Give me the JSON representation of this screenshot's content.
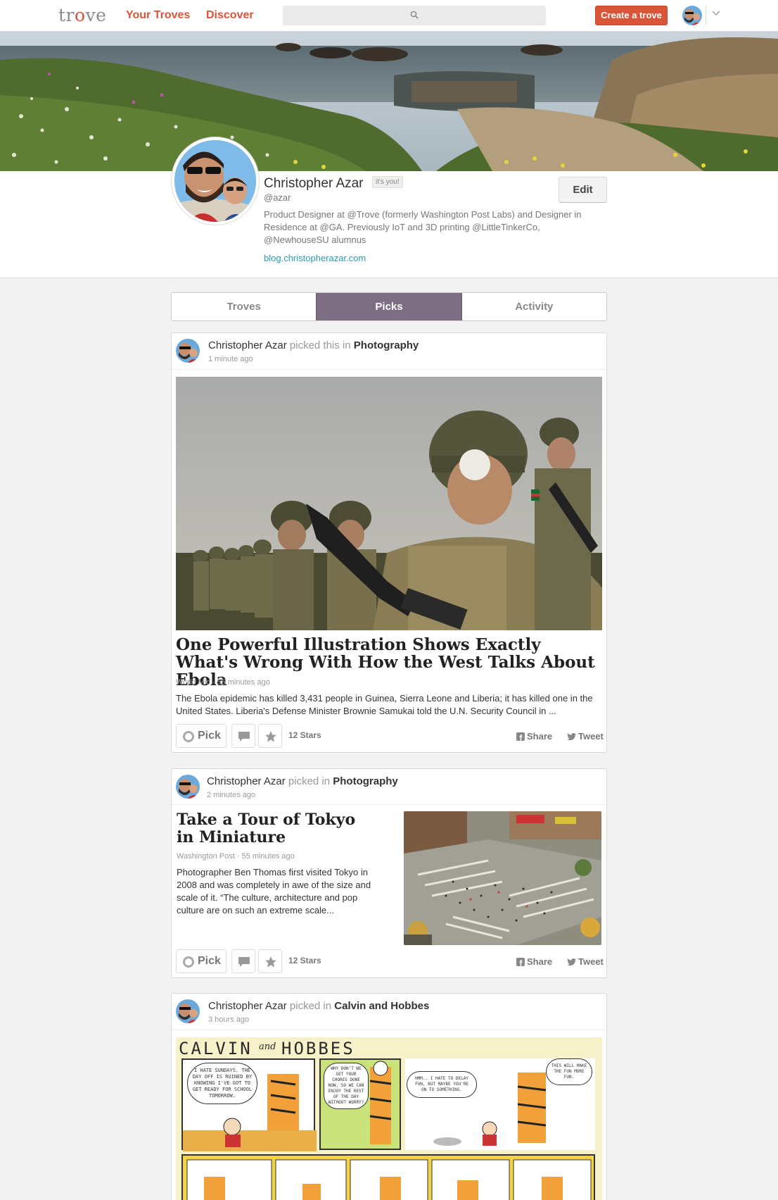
{
  "nav": {
    "logo": "trove",
    "your_troves": "Your Troves",
    "discover": "Discover",
    "search_placeholder": "",
    "create_trove": "Create a trove"
  },
  "profile": {
    "name": "Christopher Azar",
    "badge": "it's you!",
    "handle": "@azar",
    "bio": "Product Designer at @Trove (formerly Washington Post Labs) and Designer in Residence at @GA. Previously IoT and 3D printing @LittleTinkerCo, @NewhouseSU alumnus",
    "blog": "blog.christopherazar.com",
    "edit_label": "Edit"
  },
  "tabs": [
    {
      "label": "Troves",
      "active": false
    },
    {
      "label": "Picks",
      "active": true
    },
    {
      "label": "Activity",
      "active": false
    }
  ],
  "cards": [
    {
      "user": "Christopher Azar",
      "verb": "picked this in",
      "trove": "Photography",
      "ago": "1 minute ago",
      "title": "One Powerful Illustration Shows Exactly What's Wrong With How the West Talks About Ebola",
      "source": "World Mic · 55 minutes ago",
      "description": "The Ebola epidemic has killed 3,431 people in Guinea, Sierra Leone and Liberia; it has killed one in the United States. Liberia's Defense Minister Brownie Samukai told the U.N. Security Council in ...",
      "pick": "Pick",
      "stars": "12 Stars",
      "share": "Share",
      "tweet": "Tweet"
    },
    {
      "user": "Christopher Azar",
      "verb": "picked in",
      "trove": "Photography",
      "ago": "2 minutes ago",
      "title": "Take a Tour of Tokyo in Miniature",
      "source": "Washington Post · 55 minutes ago",
      "description": "Photographer Ben Thomas first visited Tokyo in 2008 and was completely in awe of the size and scale of it. “The culture, architecture and pop culture are on such an extreme scale...",
      "pick": "Pick",
      "stars": "12 Stars",
      "share": "Share",
      "tweet": "Tweet"
    },
    {
      "user": "Christopher Azar",
      "verb": "picked in",
      "trove": "Calvin and Hobbes",
      "ago": "3 hours ago",
      "comic_title_left": "CALVIN",
      "comic_title_and": "and",
      "comic_title_right": "HOBBES",
      "bubble_1": "I HATE SUNDAYS. THE DAY OFF IS RUINED BY KNOWING I'VE GOT TO GET READY FOR SCHOOL TOMORROW.",
      "bubble_2": "WHY DON'T WE GET YOUR CHORES DONE NOW, SO WE CAN ENJOY THE REST OF THE DAY WITHOUT WORRY?",
      "bubble_3": "HMM.. I HATE TO DELAY FUN, BUT MAYBE YOU'RE ON TO SOMETHING.",
      "bubble_4": "THIS WILL MAKE THE FUN MORE FUN."
    }
  ],
  "colors": {
    "brand": "#d9553a",
    "tab_active": "#7d6e83",
    "link": "#2a9bb0"
  }
}
